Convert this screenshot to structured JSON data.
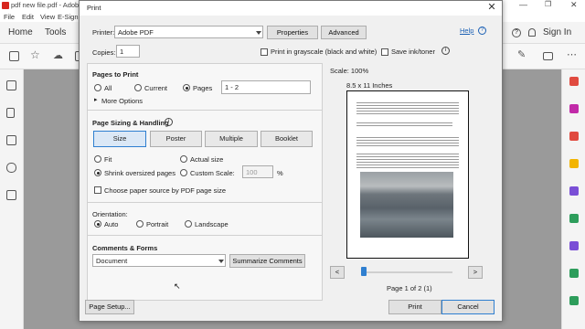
{
  "app": {
    "window_title": "pdf new file.pdf - Adobe",
    "menu": [
      "File",
      "Edit",
      "View",
      "E-Sign"
    ],
    "tabs": [
      "Home",
      "Tools"
    ],
    "sign_in": "Sign In"
  },
  "dialog": {
    "title": "Print",
    "close": "✕",
    "printer_label": "Printer:",
    "printer_value": "Adobe PDF",
    "properties": "Properties",
    "advanced": "Advanced",
    "help": "Help",
    "copies_label": "Copies:",
    "copies_value": "1",
    "grayscale_label": "Print in grayscale (black and white)",
    "save_ink_label": "Save ink/toner",
    "pages_to_print": {
      "title": "Pages to Print",
      "all": "All",
      "current": "Current",
      "pages": "Pages",
      "pages_value": "1 - 2",
      "more_options": "More Options"
    },
    "sizing": {
      "title": "Page Sizing & Handling",
      "buttons": [
        "Size",
        "Poster",
        "Multiple",
        "Booklet"
      ],
      "fit": "Fit",
      "actual_size": "Actual size",
      "shrink": "Shrink oversized pages",
      "custom_scale": "Custom Scale:",
      "custom_scale_value": "100",
      "percent": "%",
      "paper_source": "Choose paper source by PDF page size"
    },
    "orientation": {
      "title": "Orientation:",
      "auto": "Auto",
      "portrait": "Portrait",
      "landscape": "Landscape"
    },
    "comments": {
      "title": "Comments & Forms",
      "value": "Document",
      "summarize": "Summarize Comments"
    },
    "preview": {
      "scale": "Scale: 100%",
      "paper": "8.5 x 11 Inches",
      "prev": "<",
      "next": ">",
      "page_info": "Page 1 of 2 (1)"
    },
    "page_setup": "Page Setup...",
    "print": "Print",
    "cancel": "Cancel"
  },
  "colors": {
    "accent": "#2f7fd0",
    "link": "#1a5fb4",
    "adobe_red": "#d7261e"
  }
}
